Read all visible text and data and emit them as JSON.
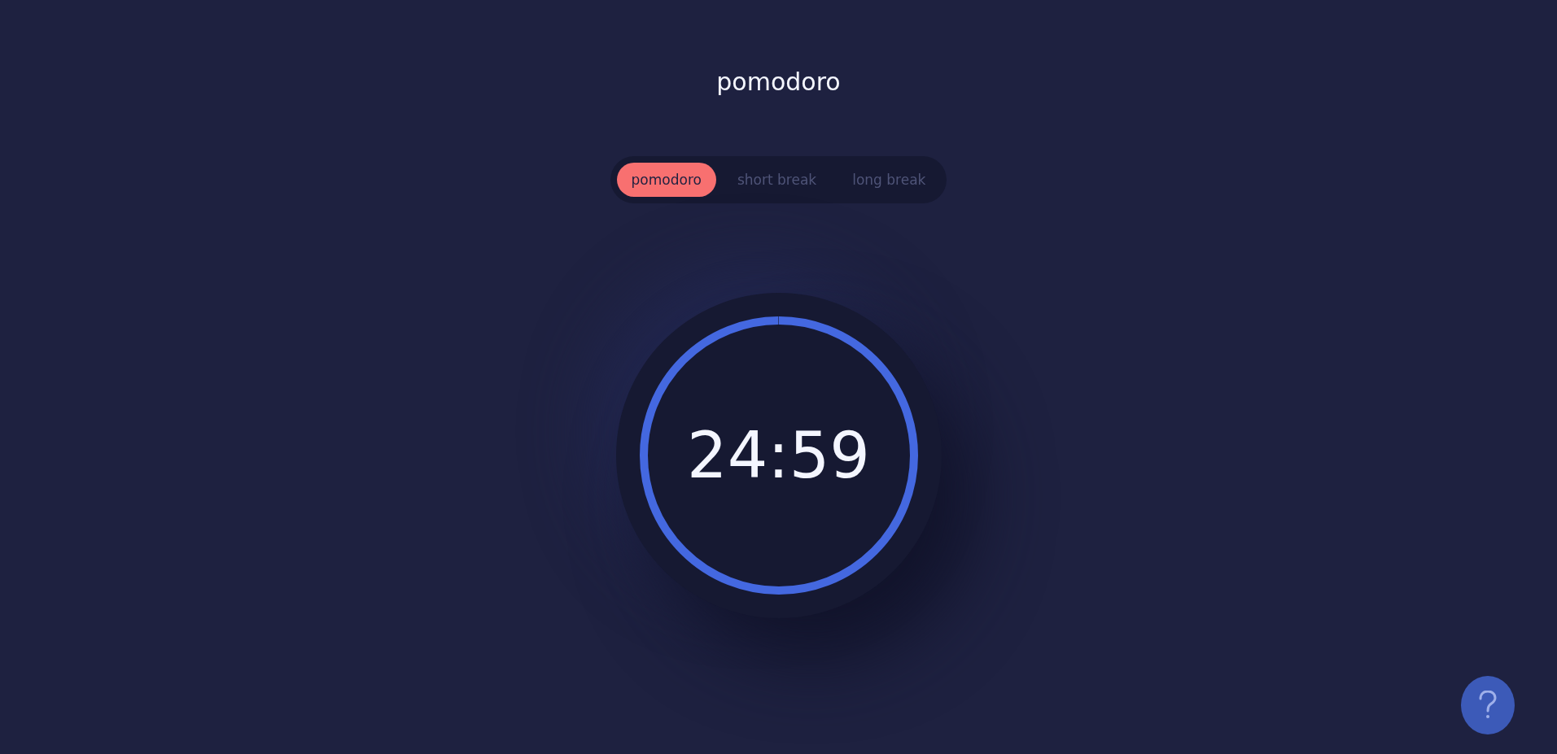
{
  "title": "pomodoro",
  "tabs": [
    {
      "label": "pomodoro",
      "selected": true
    },
    {
      "label": "short break",
      "selected": false
    },
    {
      "label": "long break",
      "selected": false
    }
  ],
  "timer": {
    "time": "24:59",
    "level": 0.999
  },
  "help_button": {
    "kind": "help"
  }
}
